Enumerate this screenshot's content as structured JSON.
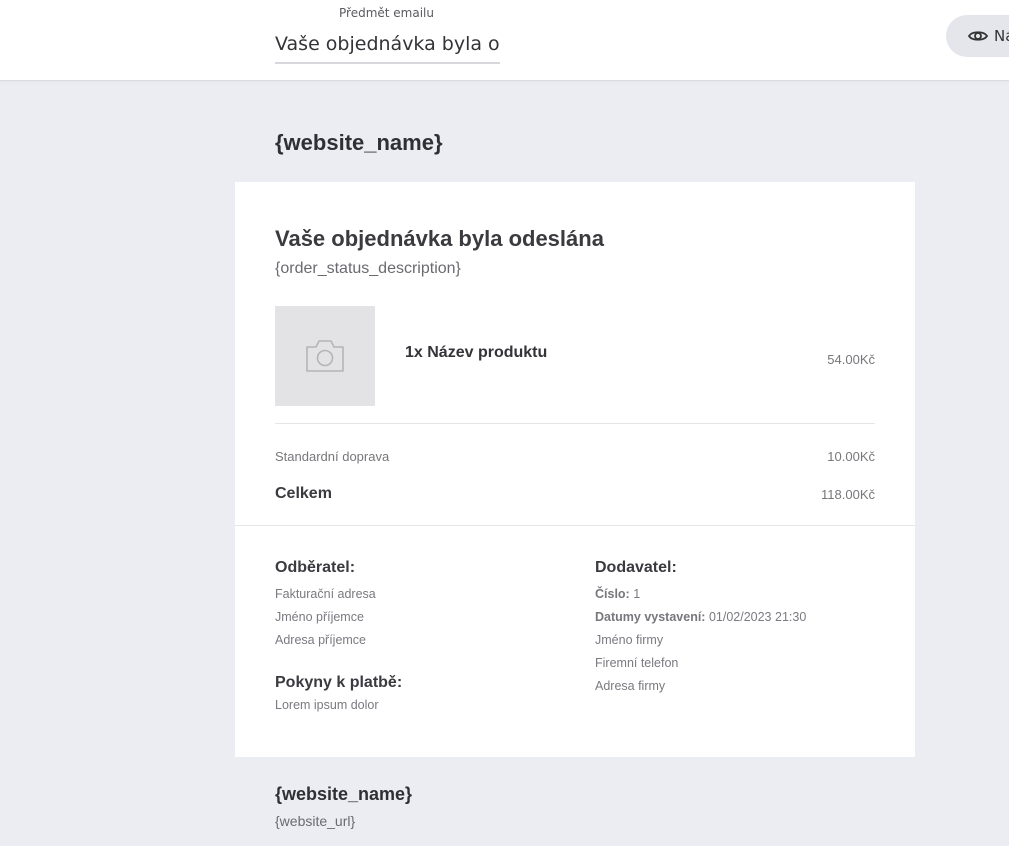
{
  "topbar": {
    "subject_label": "Předmět emailu",
    "subject_value": "Vaše objednávka byla odeslána",
    "preview_label": "Náhled"
  },
  "header": {
    "brand": "{website_name}"
  },
  "order": {
    "title": "Vaše objednávka byla odeslána",
    "description": "{order_status_description}",
    "product": {
      "icon": "camera-icon",
      "name": "1x Název produktu",
      "price": "54.00Kč"
    },
    "shipping": {
      "label": "Standardní doprava",
      "price": "10.00Kč"
    },
    "total": {
      "label": "Celkem",
      "price": "118.00Kč"
    }
  },
  "customer": {
    "heading": "Odběratel:",
    "lines": [
      "Fakturační adresa",
      "Jméno příjemce",
      "Adresa příjemce"
    ]
  },
  "supplier": {
    "heading": "Dodavatel:",
    "number_label": "Číslo:",
    "number_value": "1",
    "date_label": "Datumy vystavení:",
    "date_value": "01/02/2023 21:30",
    "lines": [
      "Jméno firmy",
      "Firemní telefon",
      "Adresa firmy"
    ]
  },
  "payment": {
    "heading": "Pokyny k platbě:",
    "text": "Lorem ipsum dolor"
  },
  "footer": {
    "brand": "{website_name}",
    "url": "{website_url}"
  },
  "colors": {
    "background": "#ebedf2",
    "card": "#ffffff",
    "image_placeholder": "#e3e3e5",
    "button": "#e4e6eb"
  }
}
